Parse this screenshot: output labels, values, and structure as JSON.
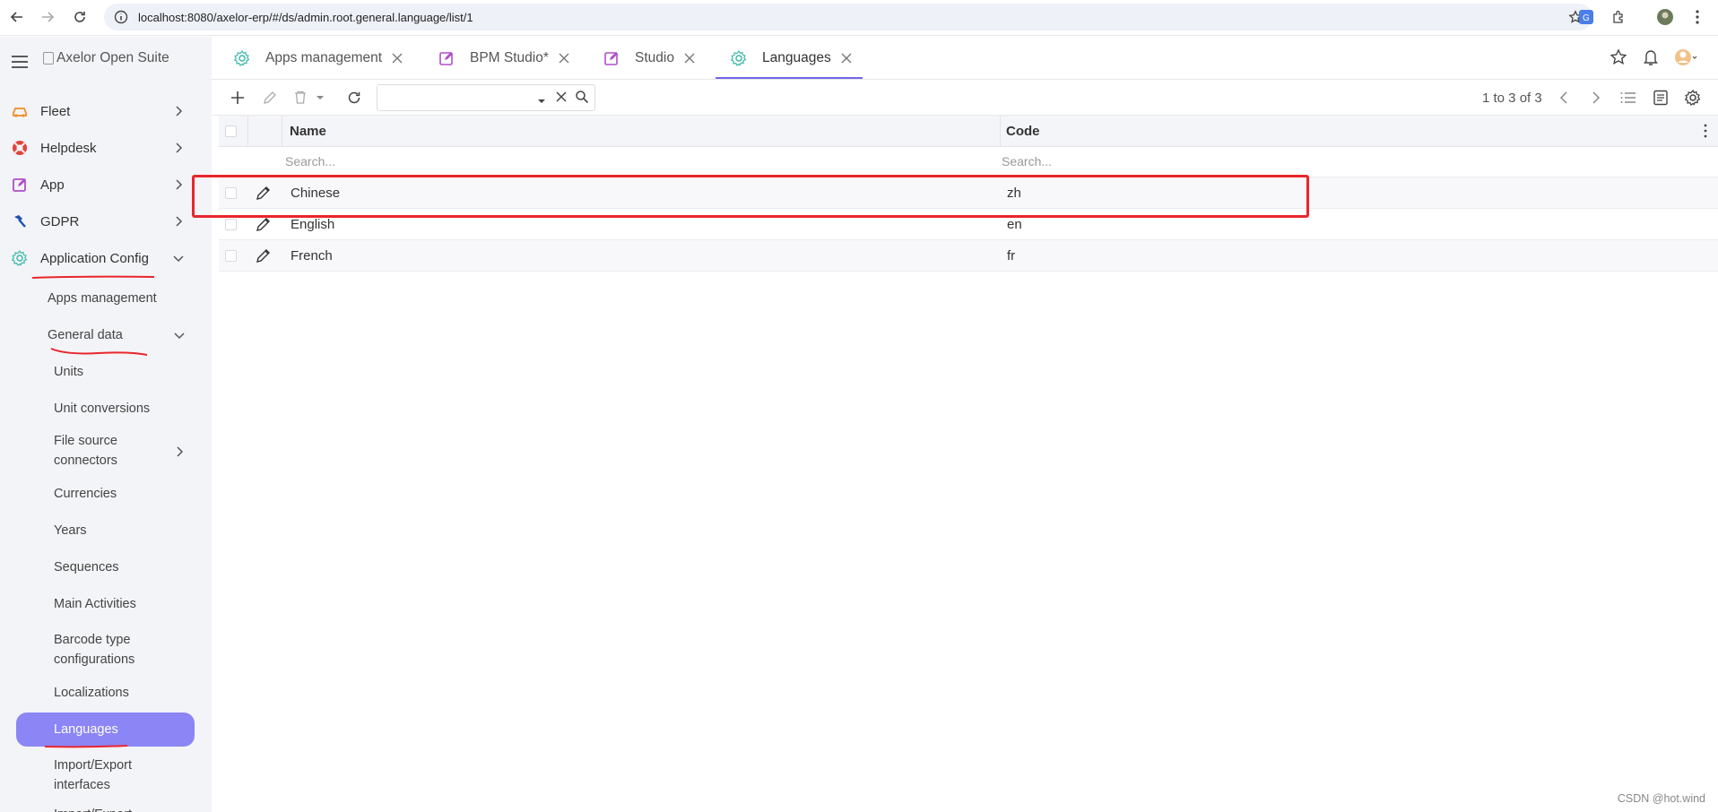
{
  "browser": {
    "url": "localhost:8080/axelor-erp/#/ds/admin.root.general.language/list/1"
  },
  "sidebar": {
    "logo_alt": "Axelor Open Suite",
    "items": [
      {
        "label": "Fleet",
        "icon": "car-icon",
        "color": "#f08c2a"
      },
      {
        "label": "Helpdesk",
        "icon": "lifebuoy-icon",
        "color": "#e0443c"
      },
      {
        "label": "App",
        "icon": "edit-square-icon",
        "color": "#b04ec8"
      },
      {
        "label": "GDPR",
        "icon": "hammer-icon",
        "color": "#1f4fb0"
      },
      {
        "label": "Application Config",
        "icon": "gear-icon",
        "color": "#3cb8a8"
      }
    ],
    "sub_items": [
      {
        "label": "Apps management"
      },
      {
        "label": "General data"
      },
      {
        "label": "Units"
      },
      {
        "label": "Unit conversions"
      },
      {
        "label": "File source connectors"
      },
      {
        "label": "Currencies"
      },
      {
        "label": "Years"
      },
      {
        "label": "Sequences"
      },
      {
        "label": "Main Activities"
      },
      {
        "label": "Barcode type configurations"
      },
      {
        "label": "Localizations"
      },
      {
        "label": "Languages"
      },
      {
        "label": "Import/Export interfaces"
      },
      {
        "label": "Import/Export"
      }
    ]
  },
  "tabs": [
    {
      "label": "Apps management",
      "icon": "gear-icon"
    },
    {
      "label": "BPM Studio*",
      "icon": "edit-square-icon"
    },
    {
      "label": "Studio",
      "icon": "edit-square-icon"
    },
    {
      "label": "Languages",
      "icon": "gear-icon"
    }
  ],
  "toolbar": {
    "search_value": "",
    "pager": "1 to 3 of 3"
  },
  "grid": {
    "columns": [
      "Name",
      "Code"
    ],
    "filter_placeholders": [
      "Search...",
      "Search..."
    ],
    "rows": [
      {
        "name": "Chinese",
        "code": "zh"
      },
      {
        "name": "English",
        "code": "en"
      },
      {
        "name": "French",
        "code": "fr"
      }
    ]
  },
  "watermark": "CSDN @hot.wind",
  "colors": {
    "accent": "#8b85f6",
    "tab_underline": "#6f67e8",
    "highlight": "#e8262c"
  }
}
